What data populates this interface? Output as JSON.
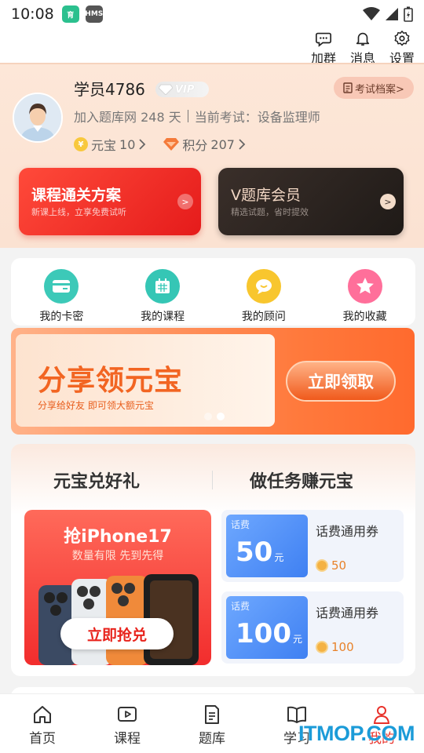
{
  "status_bar": {
    "time": "10:08",
    "badge1": "育",
    "badge2": "HMS"
  },
  "top_actions": [
    {
      "label": "加群",
      "icon": "chat-icon"
    },
    {
      "label": "消息",
      "icon": "bell-icon"
    },
    {
      "label": "设置",
      "icon": "gear-icon"
    }
  ],
  "profile": {
    "username": "学员4786",
    "vip_label": "VIP",
    "exam_file_label": "考试档案>",
    "join_days_text": "加入题库网 248 天",
    "current_exam_text": "当前考试：设备监理师",
    "yuanbao_label": "元宝",
    "yuanbao_value": "10",
    "points_label": "积分",
    "points_value": "207"
  },
  "promo_cards": [
    {
      "title": "课程通关方案",
      "subtitle": "新课上线，立享免费试听"
    },
    {
      "title": "V题库会员",
      "subtitle": "精选试题，省时提效"
    }
  ],
  "quick_links": [
    {
      "label": "我的卡密",
      "icon": "card-icon",
      "color": "#3cc9b8"
    },
    {
      "label": "我的课程",
      "icon": "calendar-icon",
      "color": "#35c6b5"
    },
    {
      "label": "我的顾问",
      "icon": "chat-bubble-icon",
      "color": "#f8c62e"
    },
    {
      "label": "我的收藏",
      "icon": "star-icon",
      "color": "#ff6f9a"
    }
  ],
  "banner": {
    "title": "分享领元宝",
    "subtitle": "分享给好友 即可领大额元宝",
    "button": "立即领取"
  },
  "reward": {
    "tab_left": "元宝兑好礼",
    "tab_right": "做任务赚元宝",
    "promo_title": "抢iPhone17",
    "promo_subtitle": "数量有限 先到先得",
    "promo_button": "立即抢兑",
    "coupons": [
      {
        "tag": "话费",
        "amount": "50",
        "unit": "元",
        "name": "话费通用券",
        "cost": "50"
      },
      {
        "tag": "话费",
        "amount": "100",
        "unit": "元",
        "name": "话费通用券",
        "cost": "100"
      }
    ]
  },
  "tabbar": [
    {
      "label": "首页",
      "icon": "home-icon"
    },
    {
      "label": "课程",
      "icon": "play-icon"
    },
    {
      "label": "题库",
      "icon": "document-icon"
    },
    {
      "label": "学习",
      "icon": "book-icon"
    },
    {
      "label": "我的",
      "icon": "person-icon",
      "active": true
    }
  ],
  "watermark": "ITMOP.COM",
  "colors": {
    "accent_red": "#e8312a",
    "banner_orange": "#f26522",
    "profile_bg": "#fde7d8"
  }
}
